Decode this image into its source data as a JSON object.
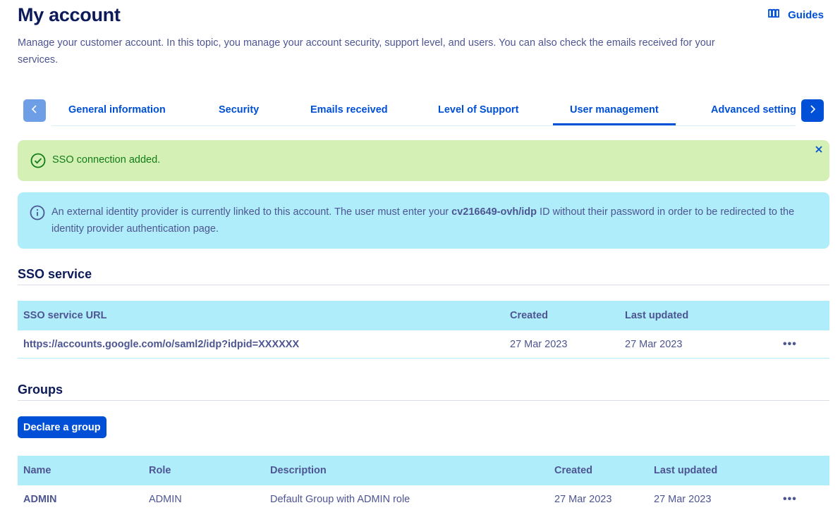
{
  "header": {
    "title": "My account",
    "guides_label": "Guides",
    "guides_icon": "book-open-icon",
    "intro": "Manage your customer account. In this topic, you manage your account security, support level, and users. You can also check the emails received for your services."
  },
  "tabs": {
    "prev_icon": "chevron-left-icon",
    "next_icon": "chevron-right-icon",
    "items": [
      {
        "label": "General information",
        "active": false
      },
      {
        "label": "Security",
        "active": false
      },
      {
        "label": "Emails received",
        "active": false
      },
      {
        "label": "Level of Support",
        "active": false
      },
      {
        "label": "User management",
        "active": true
      },
      {
        "label": "Advanced setting",
        "active": false
      }
    ]
  },
  "alerts": {
    "success": {
      "message": "SSO connection added.",
      "icon": "check-circle-icon",
      "close_icon": "close-icon"
    },
    "info": {
      "icon": "info-circle-icon",
      "text_before": "An external identity provider is currently linked to this account. The user must enter your ",
      "highlight": "cv216649-ovh/idp",
      "text_after": " ID without their password in order to be redirected to the identity provider authentication page."
    }
  },
  "sso": {
    "title": "SSO service",
    "columns": [
      "SSO service URL",
      "Created",
      "Last updated",
      ""
    ],
    "rows": [
      {
        "url": "https://accounts.google.com/o/saml2/idp?idpid=XXXXXX",
        "created": "27 Mar 2023",
        "updated": "27 Mar 2023",
        "actions": "•••"
      }
    ]
  },
  "groups": {
    "title": "Groups",
    "declare_button": "Declare a group",
    "columns": [
      "Name",
      "Role",
      "Description",
      "Created",
      "Last updated",
      ""
    ],
    "rows": [
      {
        "name": "ADMIN",
        "role": "ADMIN",
        "description": "Default Group with ADMIN role",
        "created": "27 Mar 2023",
        "updated": "27 Mar 2023",
        "actions": "•••"
      }
    ]
  },
  "colors": {
    "primary": "#0050d7",
    "heading": "#0c1a5a",
    "text": "#4d5592",
    "success_bg": "#d5f0b5",
    "success_text": "#117d17",
    "info_bg": "#b0edfb"
  }
}
